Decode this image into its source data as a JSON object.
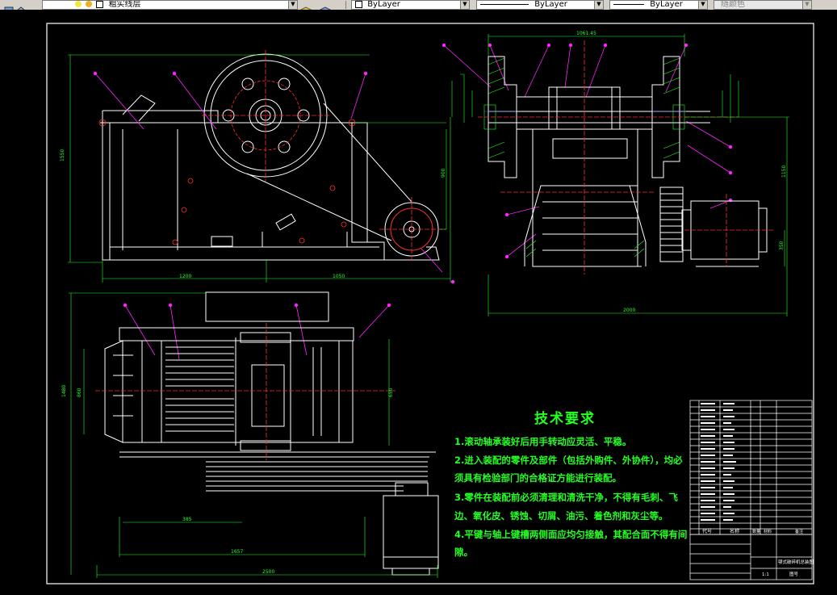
{
  "toolbar": {
    "layer_name": "粗实线层",
    "color_control": "ByLayer",
    "linetype_control": "ByLayer",
    "lineweight_control": "ByLayer",
    "plotstyle_control": "随颜色"
  },
  "drawing": {
    "dimensions": {
      "front_height": "1550",
      "front_width_left": "1200",
      "front_width_right": "1050",
      "front_inner_height": "900",
      "side_top_width": "1061.45",
      "side_height": "1150",
      "side_motor_height": "350",
      "side_width": "2000",
      "plan_height": "1480",
      "plan_inner_height": "860",
      "plan_right_height": "650",
      "plan_small_width": "385",
      "plan_mid_width": "1657",
      "plan_total_width": "2500"
    },
    "tech_requirements": {
      "title": "技术要求",
      "items": [
        "1.滚动轴承装好后用手转动应灵活、平稳。",
        "2.进入装配的零件及部件（包括外购件、外协件），均必",
        "须具有检验部门的合格证方能进行装配。",
        "3.零件在装配前必须清理和清洗干净，不得有毛刺、飞",
        "边、氧化皮、锈蚀、切屑、油污、着色剂和灰尘等。",
        "4.平键与轴上键槽两侧面应均匀接触，其配合面不得有间",
        "隙。"
      ]
    },
    "title_block": {
      "header_code": "代号",
      "header_name": "名称",
      "header_qty": "数量",
      "header_material": "材料",
      "header_remark": "备注",
      "drawing_name": "颚式破碎机总装图",
      "sheet_label": "图号",
      "scale_label": "1:1"
    }
  },
  "colors": {
    "toolbar": "#d4d0c8",
    "canvas": "#000000",
    "outline": "#ffffff",
    "dimension": "#24ff24",
    "centerline": "#ff3030",
    "leader": "#ff24ff",
    "balloon": "#ff24ff"
  }
}
